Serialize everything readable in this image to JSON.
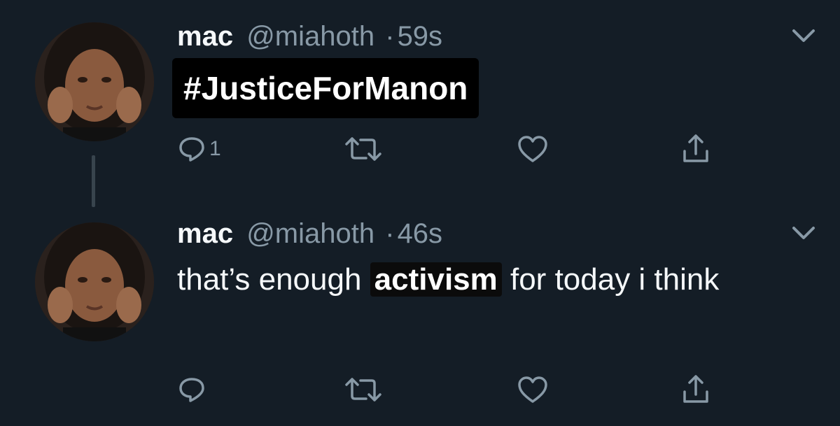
{
  "colors": {
    "background": "#141d26",
    "text": "#f5f8fa",
    "muted": "#8899a6",
    "thread_line": "#38444d",
    "highlight_box": "#000000"
  },
  "tweets": [
    {
      "author": {
        "name": "mac",
        "handle": "@miahoth"
      },
      "separator": "·",
      "time": "59s",
      "hashtag": "#JusticeForManon",
      "actions": {
        "reply_icon": "reply-icon",
        "reply_count": "1",
        "retweet_icon": "retweet-icon",
        "like_icon": "heart-icon",
        "share_icon": "share-icon"
      }
    },
    {
      "author": {
        "name": "mac",
        "handle": "@miahoth"
      },
      "separator": "·",
      "time": "46s",
      "text_before": "that’s enough ",
      "text_highlight": "activism",
      "text_after": " for today i think",
      "actions": {
        "reply_icon": "reply-icon",
        "retweet_icon": "retweet-icon",
        "like_icon": "heart-icon",
        "share_icon": "share-icon"
      }
    }
  ]
}
